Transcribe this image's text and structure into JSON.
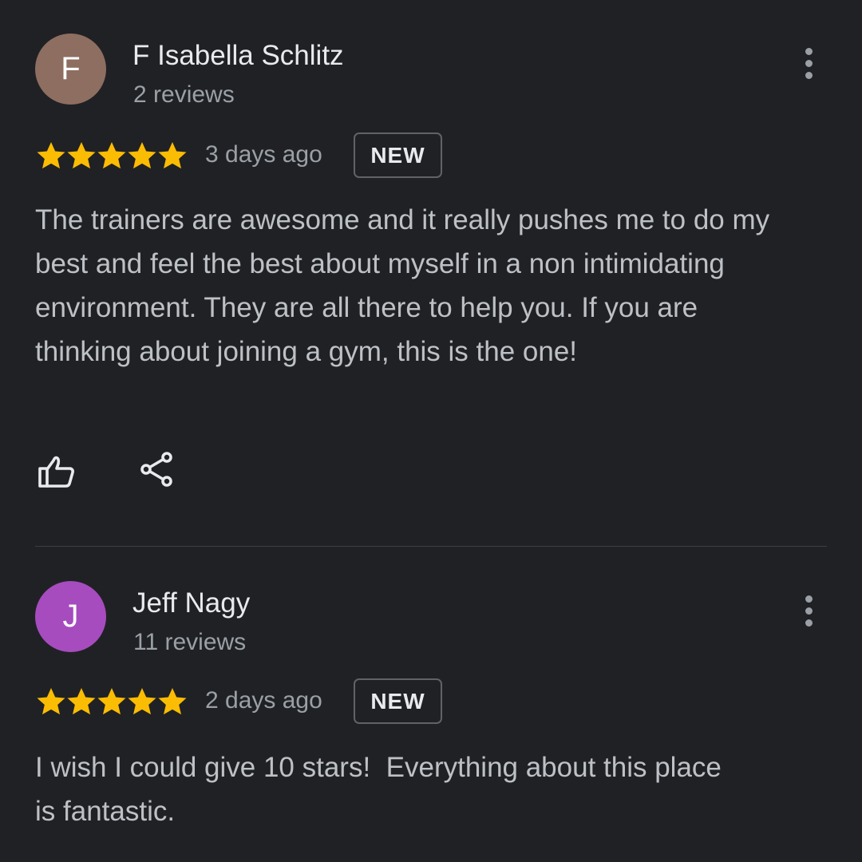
{
  "reviews": [
    {
      "avatar_letter": "F",
      "avatar_color": "#8e6e61",
      "author": "F Isabella Schlitz",
      "review_count": "2 reviews",
      "rating": 5,
      "time_ago": "3 days ago",
      "badge": "NEW",
      "text": "The trainers are awesome and it really pushes me to do my best and feel the best about myself in a non intimidating environment. They are all there to help you. If you are thinking about joining a gym, this is the one!",
      "actions": [
        "thumbs-up-icon",
        "share-icon"
      ]
    },
    {
      "avatar_letter": "J",
      "avatar_color": "#a64cbf",
      "author": "Jeff Nagy",
      "review_count": "11 reviews",
      "rating": 5,
      "time_ago": "2 days ago",
      "badge": "NEW",
      "text": "I wish I could give 10 stars!  Everything about this place is fantastic."
    }
  ],
  "colors": {
    "background": "#202124",
    "star": "#fbbc04",
    "primary_text": "#e8eaed",
    "secondary_text": "#9aa0a6"
  }
}
